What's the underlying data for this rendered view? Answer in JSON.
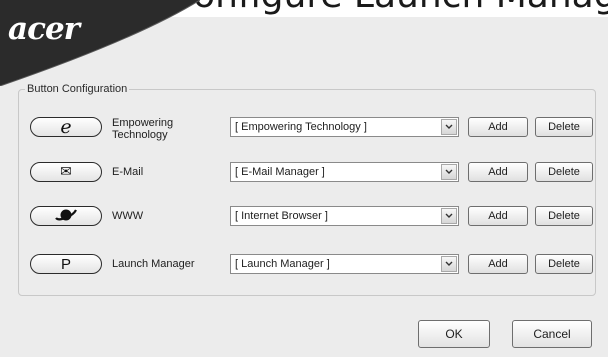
{
  "window": {
    "title": "Configure Launch Manager"
  },
  "brand": {
    "logo": "acer"
  },
  "group": {
    "label": "Button Configuration"
  },
  "rows": [
    {
      "icon": "e",
      "icon_name": "ie-e-icon",
      "label": "Empowering Technology",
      "selected": "[ Empowering Technology ]",
      "add": "Add",
      "delete": "Delete"
    },
    {
      "icon": "✉",
      "icon_name": "envelope-icon",
      "label": "E-Mail",
      "selected": "[ E-Mail Manager ]",
      "add": "Add",
      "delete": "Delete"
    },
    {
      "icon": "",
      "icon_name": "planet-icon",
      "label": "WWW",
      "selected": "[ Internet Browser ]",
      "add": "Add",
      "delete": "Delete"
    },
    {
      "icon": "P",
      "icon_name": "p-letter-icon",
      "label": "Launch Manager",
      "selected": "[ Launch Manager ]",
      "add": "Add",
      "delete": "Delete"
    }
  ],
  "footer": {
    "ok": "OK",
    "cancel": "Cancel"
  },
  "colors": {
    "banner": "#2b2b2b",
    "window_bg": "#ececec",
    "group_border": "#c8c8c8"
  }
}
